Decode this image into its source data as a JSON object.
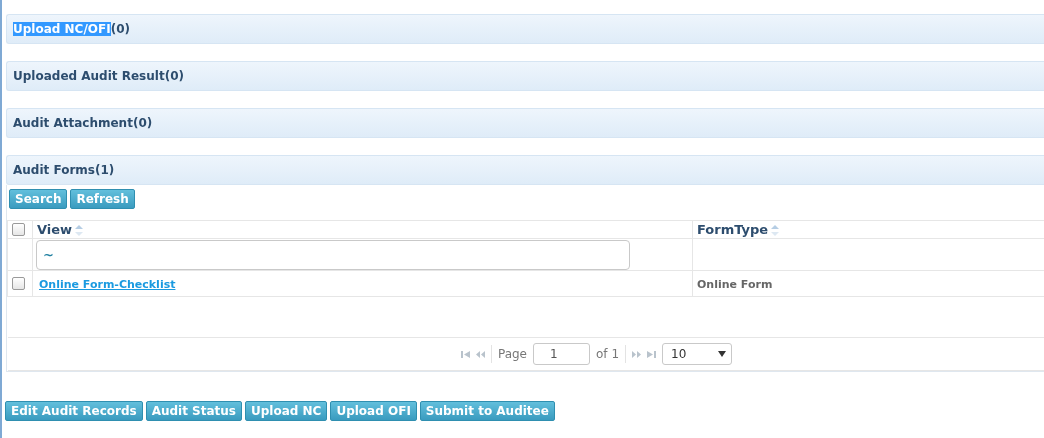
{
  "panels": [
    {
      "title": "Upload NC/OFI",
      "count": "(0)",
      "text_selected": true
    },
    {
      "title": "Uploaded Audit Result",
      "count": "(0)",
      "text_selected": false
    },
    {
      "title": "Audit Attachment",
      "count": "(0)",
      "text_selected": false
    }
  ],
  "audit_forms": {
    "title": "Audit Forms",
    "count": "(1)",
    "text_selected": false,
    "toolbar": [
      "Search",
      "Refresh"
    ],
    "select_all": {
      "checked": false
    },
    "columns": [
      {
        "label": "View"
      },
      {
        "label": "FormType"
      }
    ],
    "filter": {
      "value": "~"
    },
    "rows": [
      {
        "checked": false,
        "view": "Online Form-Checklist",
        "form_type": "Online Form"
      }
    ],
    "pager": {
      "page_label": "Page",
      "page": "1",
      "of_label": "of 1",
      "page_size": "10"
    }
  },
  "buttons": [
    "Edit Audit Records",
    "Audit Status",
    "Upload NC",
    "Upload OFI",
    "Submit to Auditee"
  ]
}
